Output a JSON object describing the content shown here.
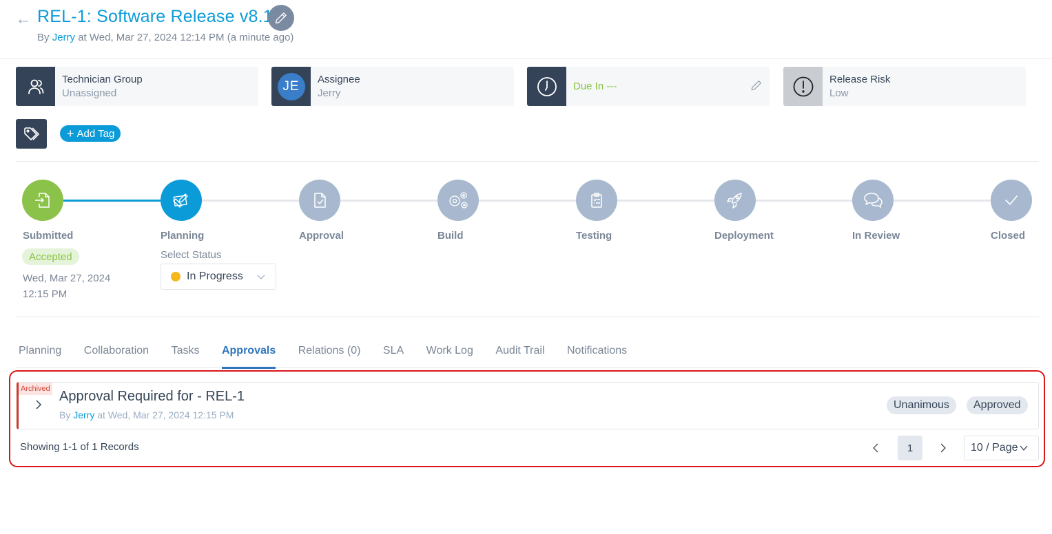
{
  "header": {
    "title": "REL-1: Software Release v8.1",
    "by_prefix": "By ",
    "author": "Jerry",
    "created_suffix": " at Wed, Mar 27, 2024 12:14 PM (a minute ago)"
  },
  "cards": {
    "technician_group": {
      "label": "Technician Group",
      "value": "Unassigned"
    },
    "assignee": {
      "label": "Assignee",
      "value": "Jerry",
      "initials": "JE"
    },
    "due": {
      "label": "Due In ---"
    },
    "release_risk": {
      "label": "Release Risk",
      "value": "Low"
    }
  },
  "tags": {
    "add_label": "Add Tag"
  },
  "stages": [
    {
      "label": "Submitted",
      "state": "done",
      "icon": "file-import-icon"
    },
    {
      "label": "Planning",
      "state": "current",
      "icon": "planning-icon"
    },
    {
      "label": "Approval",
      "state": "pending",
      "icon": "document-check-icon"
    },
    {
      "label": "Build",
      "state": "pending",
      "icon": "gears-icon"
    },
    {
      "label": "Testing",
      "state": "pending",
      "icon": "clipboard-list-icon"
    },
    {
      "label": "Deployment",
      "state": "pending",
      "icon": "rocket-icon"
    },
    {
      "label": "In Review",
      "state": "pending",
      "icon": "chat-bubbles-icon"
    },
    {
      "label": "Closed",
      "state": "pending",
      "icon": "check-icon"
    }
  ],
  "submitted": {
    "status": "Accepted",
    "date_line1": "Wed, Mar 27, 2024",
    "date_line2": "12:15 PM"
  },
  "planning": {
    "select_label": "Select Status",
    "selected": "In Progress",
    "status_color": "#f4b81c"
  },
  "tabs": [
    {
      "label": "Planning",
      "active": false
    },
    {
      "label": "Collaboration",
      "active": false
    },
    {
      "label": "Tasks",
      "active": false
    },
    {
      "label": "Approvals",
      "active": true
    },
    {
      "label": "Relations (0)",
      "active": false
    },
    {
      "label": "SLA",
      "active": false
    },
    {
      "label": "Work Log",
      "active": false
    },
    {
      "label": "Audit Trail",
      "active": false
    },
    {
      "label": "Notifications",
      "active": false
    }
  ],
  "approvals": [
    {
      "badge": "Archived",
      "title": "Approval Required for - REL-1",
      "by_prefix": "By ",
      "author": "Jerry",
      "created_suffix": " at Wed, Mar 27, 2024 12:15 PM",
      "type": "Unanimous",
      "status": "Approved"
    }
  ],
  "pagination": {
    "records_text": "Showing 1-1 of 1 Records",
    "current_page": "1",
    "per_page": "10 / Page"
  },
  "colors": {
    "brand": "#0b9bd8",
    "done": "#8bc34a",
    "pending": "#a8b9cf",
    "dark": "#344357",
    "archived": "#c9392c"
  }
}
